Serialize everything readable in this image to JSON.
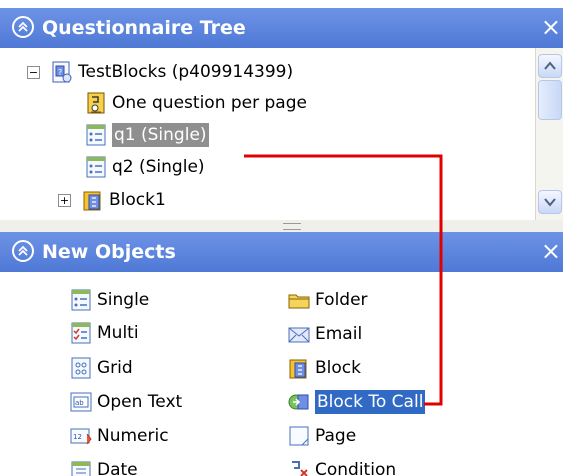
{
  "questionnaire_tree": {
    "title": "Questionnaire Tree",
    "close_label": "×",
    "root": {
      "expander": "−",
      "label": "TestBlocks (p409914399)"
    },
    "items": [
      {
        "label": "One question per page",
        "icon": "page-settings-icon"
      },
      {
        "label": "q1 (Single)",
        "icon": "single-question-icon",
        "selected": true
      },
      {
        "label": "q2 (Single)",
        "icon": "single-question-icon"
      },
      {
        "label": "Block1",
        "icon": "block-icon",
        "expander": "+"
      }
    ]
  },
  "new_objects": {
    "title": "New Objects",
    "close_label": "×",
    "left_column": [
      {
        "label": "Single",
        "icon": "single-question-icon"
      },
      {
        "label": "Multi",
        "icon": "multi-question-icon"
      },
      {
        "label": "Grid",
        "icon": "grid-question-icon"
      },
      {
        "label": "Open Text",
        "icon": "open-text-icon"
      },
      {
        "label": "Numeric",
        "icon": "numeric-icon"
      },
      {
        "label": "Date",
        "icon": "date-icon"
      }
    ],
    "right_column": [
      {
        "label": "Folder",
        "icon": "folder-icon"
      },
      {
        "label": "Email",
        "icon": "email-icon"
      },
      {
        "label": "Block",
        "icon": "block-icon"
      },
      {
        "label": "Block To Call",
        "icon": "block-to-call-icon",
        "selected": true
      },
      {
        "label": "Page",
        "icon": "page-icon"
      },
      {
        "label": "Condition",
        "icon": "condition-icon"
      }
    ]
  },
  "colors": {
    "header": "#4f79d6",
    "selection_blue": "#316ac5",
    "selection_gray": "#8f8f8f",
    "annotation": "#e00000"
  }
}
